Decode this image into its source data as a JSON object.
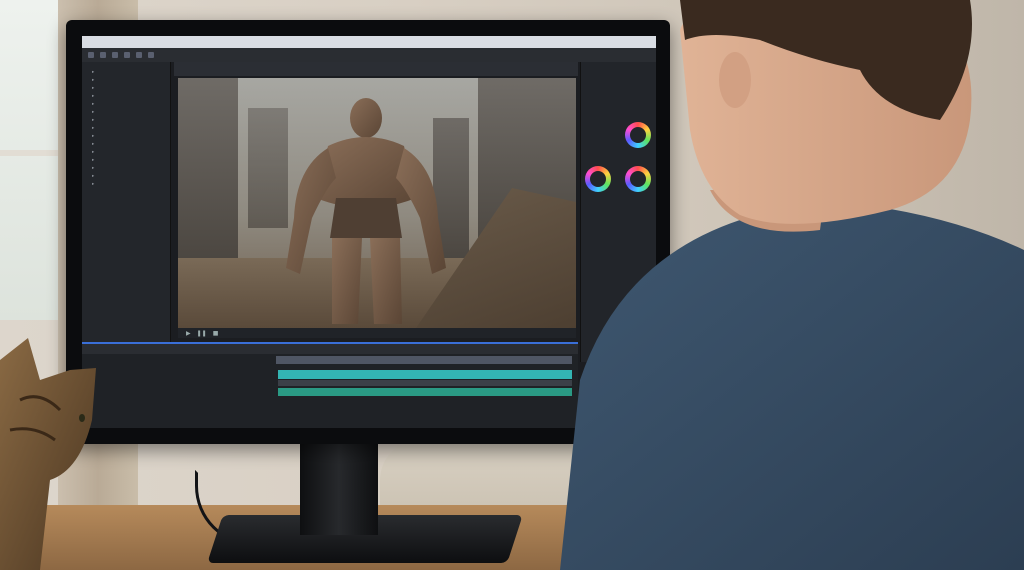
{
  "scene": {
    "description_colors": {
      "wall": "#d8cfc3",
      "desk": "#b68a5b",
      "shirt": "#3b526a",
      "hair": "#3a2a1f",
      "skin": "#d9a98a",
      "accent_timeline": "#3a6fd8",
      "track_cyan": "#33b5b3",
      "track_green": "#2a9a84"
    }
  },
  "app": {
    "menu_items": [
      "",
      "",
      "",
      "",
      "",
      "",
      "",
      ""
    ],
    "viewer_tab_label": "",
    "panel_left_title": "",
    "project_items": [
      "",
      "",
      "",
      "",
      "",
      "",
      "",
      "",
      "",
      "",
      "",
      "",
      "",
      "",
      "",
      "",
      "",
      "",
      ""
    ],
    "timeline_label": "",
    "layers": [
      {
        "name": "",
        "mode": ""
      },
      {
        "name": "",
        "mode": ""
      },
      {
        "name": "",
        "mode": ""
      },
      {
        "name": "",
        "mode": ""
      },
      {
        "name": "",
        "mode": ""
      },
      {
        "name": "",
        "mode": ""
      }
    ],
    "icons": [
      "play-icon",
      "pause-icon",
      "stop-icon",
      "color-wheel-icon"
    ]
  }
}
